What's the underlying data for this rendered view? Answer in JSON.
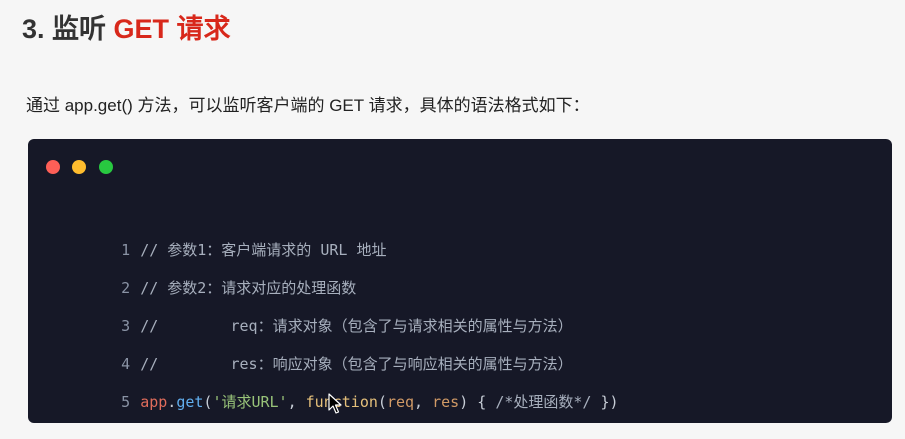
{
  "heading": {
    "number": "3. 监听",
    "accent": "GET 请求"
  },
  "intro": "通过 app.get() 方法，可以监听客户端的 GET 请求，具体的语法格式如下：",
  "code_window": {
    "controls": [
      "red-dot",
      "yellow-dot",
      "green-dot"
    ],
    "colors": {
      "background": "#161827",
      "red": "#fd5f57",
      "yellow": "#febc2e",
      "green": "#28c840"
    },
    "lines": [
      {
        "num": "1",
        "text": "// 参数1：客户端请求的 URL 地址"
      },
      {
        "num": "2",
        "text": "// 参数2：请求对应的处理函数"
      },
      {
        "num": "3",
        "text": "//        req：请求对象（包含了与请求相关的属性与方法）"
      },
      {
        "num": "4",
        "text": "//        res：响应对象（包含了与响应相关的属性与方法）"
      },
      {
        "num": "5",
        "tokens": {
          "obj": "app",
          "dot": ".",
          "method": "get",
          "open": "(",
          "str": "'请求URL'",
          "comma1": ", ",
          "kw": "function",
          "paren_open": "(",
          "p1": "req",
          "comma2": ", ",
          "p2": "res",
          "paren_close": ")",
          "brace_open": " { ",
          "cmt": "/*处理函数*/",
          "brace_close": " })"
        }
      }
    ]
  },
  "accent_color": "#d8281b"
}
